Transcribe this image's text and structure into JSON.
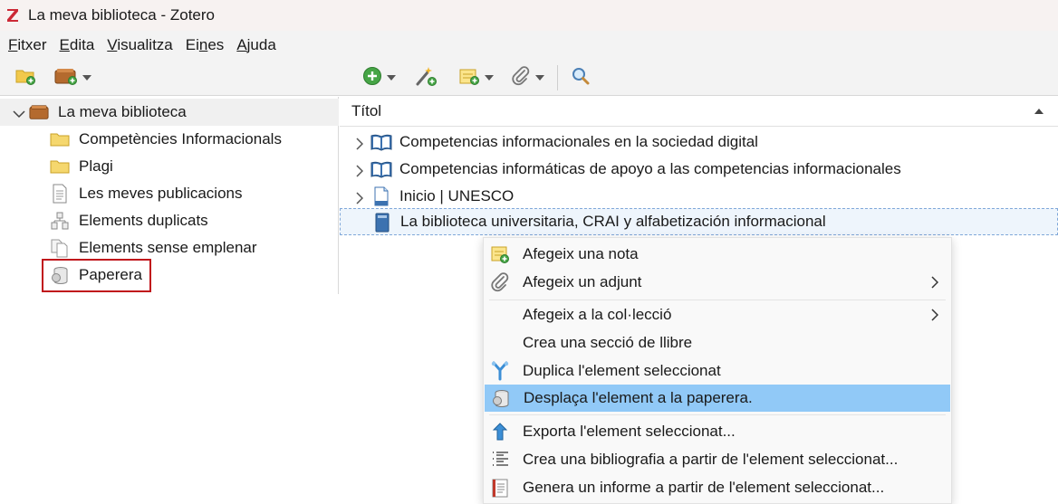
{
  "window": {
    "title": "La meva biblioteca - Zotero"
  },
  "menubar": [
    {
      "pre": "",
      "u": "F",
      "post": "itxer"
    },
    {
      "pre": "",
      "u": "E",
      "post": "dita"
    },
    {
      "pre": "",
      "u": "V",
      "post": "isualitza"
    },
    {
      "pre": "Ei",
      "u": "n",
      "post": "es"
    },
    {
      "pre": "",
      "u": "A",
      "post": "juda"
    }
  ],
  "toolbar": {
    "icons": [
      "new-collection-icon",
      "new-library-icon",
      "new-item-icon",
      "add-by-identifier-icon",
      "new-note-icon",
      "add-attachment-icon",
      "search-icon"
    ]
  },
  "collections": {
    "library": "La meva biblioteca",
    "items": [
      {
        "label": "Competències Informacionals",
        "icon": "folder-icon"
      },
      {
        "label": "Plagi",
        "icon": "folder-icon"
      },
      {
        "label": "Les meves publicacions",
        "icon": "document-icon"
      },
      {
        "label": "Elements duplicats",
        "icon": "duplicate-icon"
      },
      {
        "label": "Elements sense emplenar",
        "icon": "unfiled-icon"
      },
      {
        "label": "Paperera",
        "icon": "trash-icon"
      }
    ]
  },
  "items_list": {
    "column_title": "Títol",
    "rows": [
      {
        "title": "Competencias informacionales en la sociedad digital",
        "icon": "book-icon"
      },
      {
        "title": "Competencias informáticas de apoyo a las competencias informacionales",
        "icon": "book-icon"
      },
      {
        "title": "Inicio | UNESCO",
        "icon": "webpage-icon"
      },
      {
        "title": "La biblioteca universitaria, CRAI y alfabetización informacional",
        "icon": "journal-icon"
      }
    ]
  },
  "context_menu": {
    "items": [
      {
        "label": "Afegeix una nota",
        "icon": "add-note-icon"
      },
      {
        "label": "Afegeix un adjunt",
        "icon": "paperclip-icon",
        "submenu": true
      },
      {
        "label": "Afegeix a la col·lecció",
        "submenu": true
      },
      {
        "label": "Crea una secció de llibre"
      },
      {
        "label": "Duplica l'element seleccionat",
        "icon": "duplicate-item-icon"
      },
      {
        "label": "Desplaça l'element a la paperera.",
        "icon": "trash-icon",
        "highlighted": true
      },
      {
        "label": "Exporta l'element seleccionat...",
        "icon": "export-icon"
      },
      {
        "label": "Crea una bibliografia a partir de l'element seleccionat...",
        "icon": "bibliography-icon"
      },
      {
        "label": "Genera un informe a partir de l'element seleccionat...",
        "icon": "report-icon"
      }
    ]
  },
  "colors": {
    "highlight": "#91c9f7",
    "annotation_box": "#c0141b",
    "zotero_red": "#cc2936"
  }
}
